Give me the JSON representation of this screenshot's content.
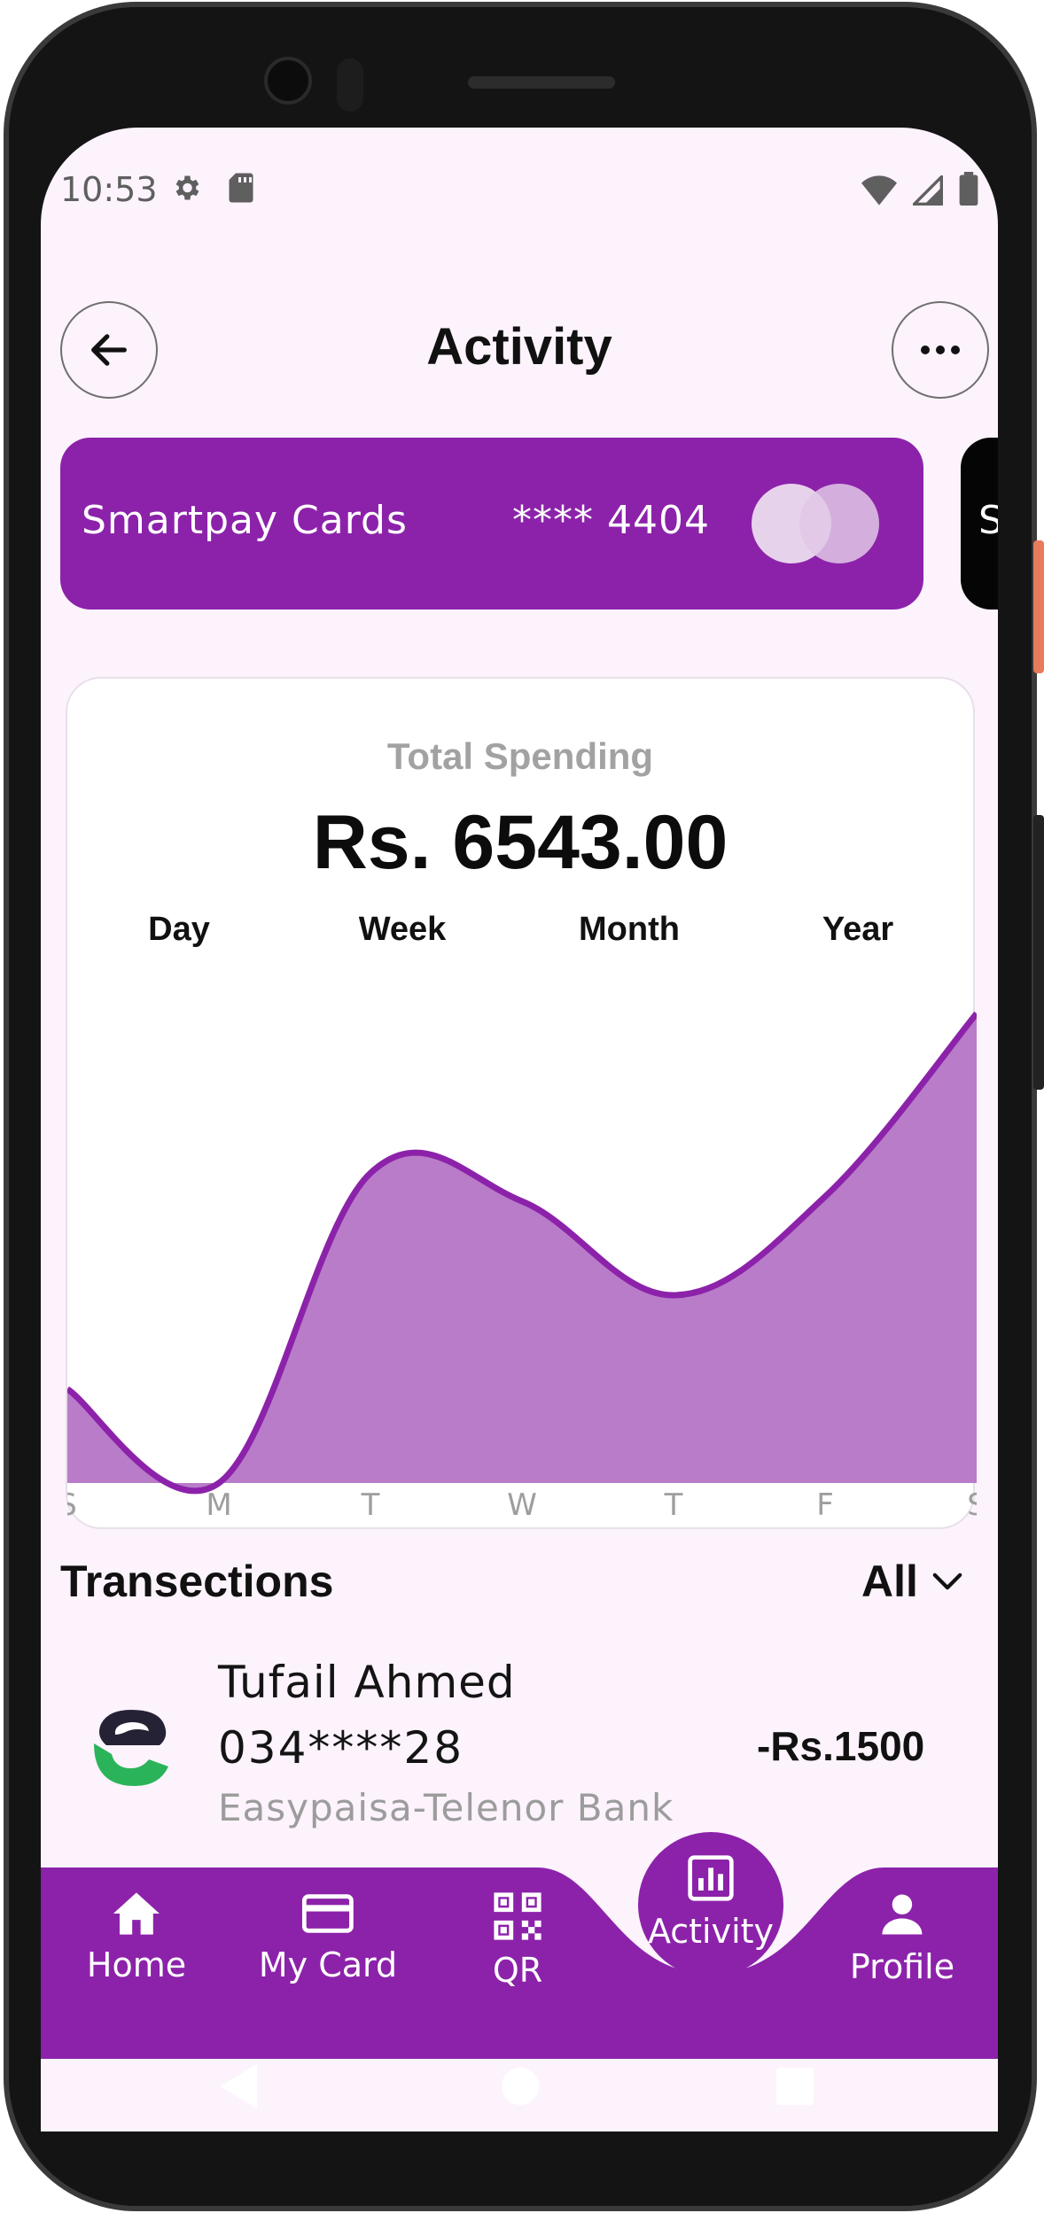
{
  "status_bar": {
    "time": "10:53",
    "left_icons": [
      "settings-icon",
      "sd-card-icon"
    ],
    "right_icons": [
      "wifi-icon",
      "signal-icon",
      "battery-icon"
    ]
  },
  "header": {
    "title": "Activity",
    "back_icon": "arrow-left-icon",
    "more_icon": "more-horizontal-icon"
  },
  "cards": [
    {
      "name": "Smartpay Cards",
      "number": "**** 4404",
      "color": "#8c22aa"
    },
    {
      "name": "S",
      "color": "#050505"
    }
  ],
  "spending": {
    "label": "Total Spending",
    "total": "Rs. 6543.00",
    "periods": [
      "Day",
      "Week",
      "Month",
      "Year"
    ]
  },
  "chart_data": {
    "type": "area",
    "x": [
      "S",
      "M",
      "T",
      "W",
      "T",
      "F",
      "S"
    ],
    "series": [
      {
        "values": [
          20,
          0,
          66,
          60,
          40,
          61,
          100
        ]
      }
    ],
    "ylim": [
      0,
      100
    ],
    "grid": false,
    "fill_color": "#b97cc9",
    "line_color": "#8c22aa"
  },
  "transactions": {
    "heading": "Transections",
    "filter": "All",
    "items": [
      {
        "name": "Tufail Ahmed",
        "phone": "034****28",
        "bank": "Easypaisa-Telenor Bank",
        "amount": "-Rs.1500",
        "logo": "easypaisa-logo"
      }
    ]
  },
  "bottom_nav": {
    "color": "#8c22aa",
    "items": [
      {
        "label": "Home",
        "icon": "home-icon"
      },
      {
        "label": "My Card",
        "icon": "credit-card-icon"
      },
      {
        "label": "QR",
        "icon": "qr-code-icon"
      },
      {
        "label": "Activity",
        "icon": "bar-chart-icon",
        "active": true
      },
      {
        "label": "Profile",
        "icon": "person-icon"
      }
    ]
  },
  "system_nav": [
    "back-triangle-icon",
    "home-circle-icon",
    "recents-square-icon"
  ]
}
